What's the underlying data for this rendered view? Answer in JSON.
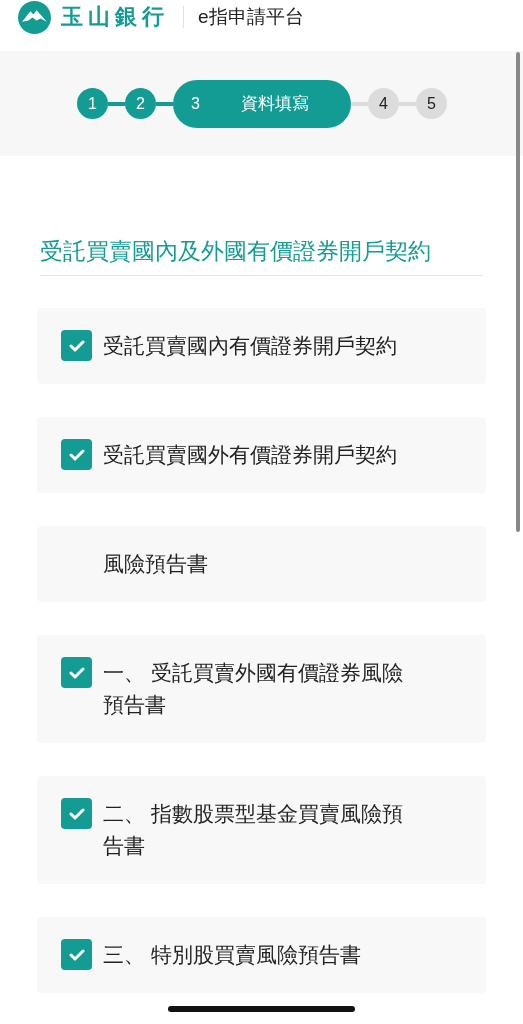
{
  "header": {
    "bank_name": "玉山銀行",
    "platform": "e指申請平台"
  },
  "stepper": [
    {
      "number": "1",
      "kind": "done"
    },
    {
      "number": "2",
      "kind": "done"
    },
    {
      "number": "3",
      "kind": "current",
      "title": "資料填寫"
    },
    {
      "number": "4",
      "kind": "todo"
    },
    {
      "number": "5",
      "kind": "todo"
    }
  ],
  "section_title": "受託買賣國內及外國有價證券開戶契約",
  "items": [
    {
      "kind": "checkbox",
      "text": "受託買賣國內有價證券開戶契約",
      "checked": true
    },
    {
      "kind": "checkbox",
      "text": "受託買賣國外有價證券開戶契約",
      "checked": true
    },
    {
      "kind": "heading",
      "text": "風險預告書"
    },
    {
      "kind": "checkbox",
      "text": "一、 受託買賣外國有價證券風險預告書",
      "checked": true
    },
    {
      "kind": "checkbox",
      "text": "二、 指數股票型基金買賣風險預告書",
      "checked": true
    },
    {
      "kind": "checkbox",
      "text": "三、 特別股買賣風險預告書",
      "checked": true
    }
  ]
}
